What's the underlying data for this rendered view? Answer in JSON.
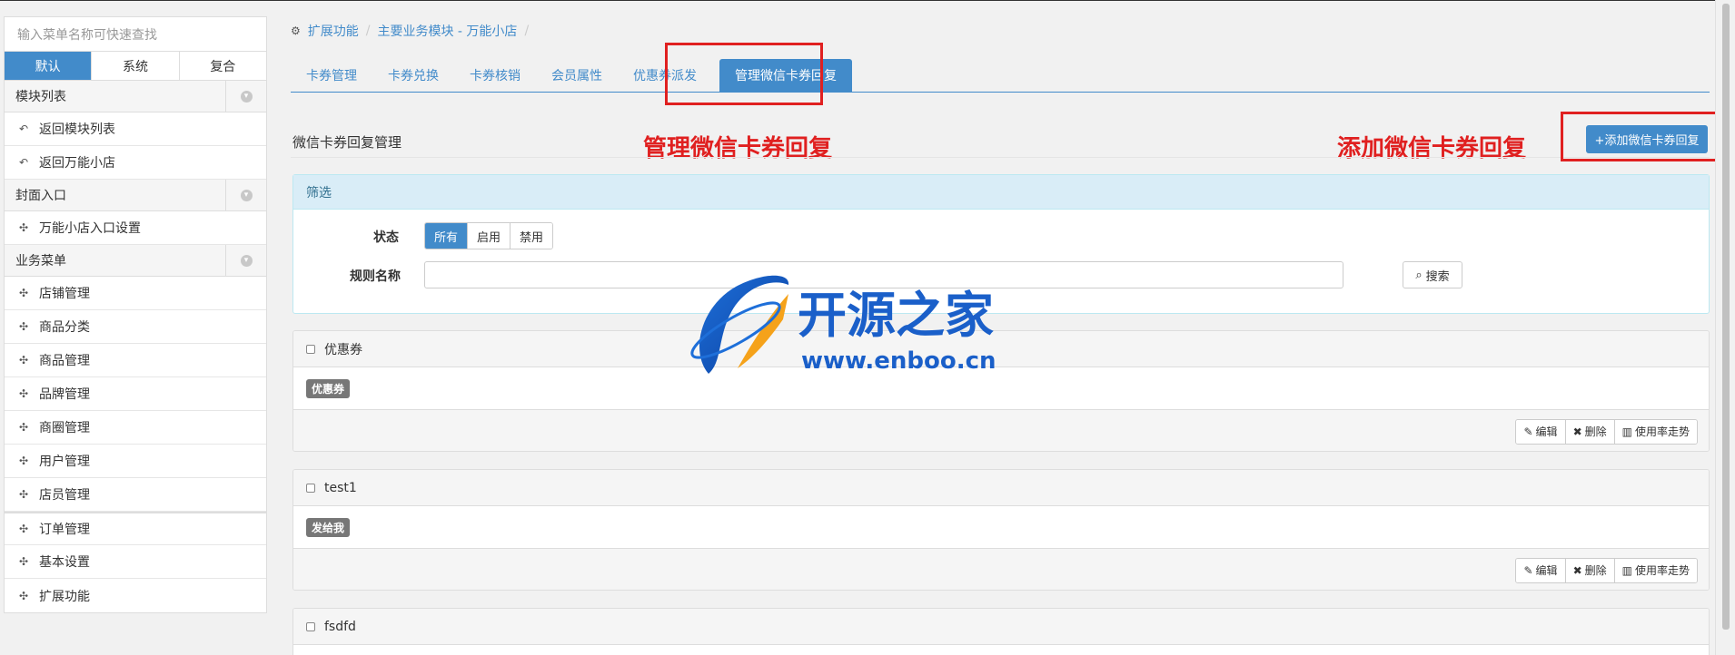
{
  "sidebar": {
    "search_placeholder": "输入菜单名称可快速查找",
    "modes": [
      "默认",
      "系统",
      "复合"
    ],
    "groups": [
      {
        "title": "模块列表",
        "items": [
          "返回模块列表",
          "返回万能小店"
        ]
      },
      {
        "title": "封面入口",
        "items": [
          "万能小店入口设置"
        ]
      },
      {
        "title": "业务菜单",
        "items": [
          "店铺管理",
          "商品分类",
          "商品管理",
          "品牌管理",
          "商圈管理",
          "用户管理",
          "店员管理"
        ]
      }
    ],
    "extra_items": [
      "订单管理",
      "基本设置",
      "扩展功能"
    ]
  },
  "breadcrumb": [
    "扩展功能",
    "主要业务模块 - 万能小店"
  ],
  "tabs": [
    "卡券管理",
    "卡券兑换",
    "卡券核销",
    "会员属性",
    "优惠券派发",
    "管理微信卡券回复"
  ],
  "annotations": {
    "manage": "管理微信卡券回复",
    "add": "添加微信卡券回复"
  },
  "section": {
    "title": "微信卡券回复管理",
    "add_button": "+添加微信卡券回复"
  },
  "filter": {
    "header": "筛选",
    "status_label": "状态",
    "status_options": [
      "所有",
      "启用",
      "禁用"
    ],
    "name_label": "规则名称",
    "search_button": "搜索"
  },
  "cards": [
    {
      "title": "优惠券",
      "badge": "优惠券"
    },
    {
      "title": "test1",
      "badge": "发给我"
    },
    {
      "title": "fsdfd",
      "badge": ""
    }
  ],
  "card_actions": [
    "编辑",
    "删除",
    "使用率走势"
  ],
  "watermark": {
    "brand": "开源之家",
    "url": "www.enboo.cn"
  }
}
